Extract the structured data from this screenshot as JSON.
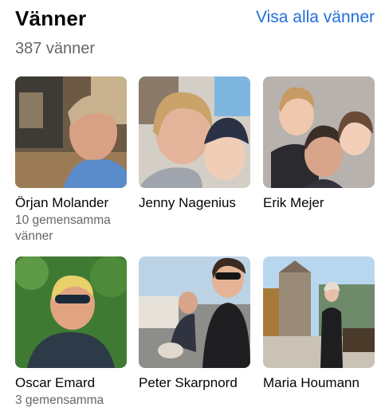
{
  "header": {
    "title": "Vänner",
    "friend_count": "387 vänner",
    "see_all_label": "Visa alla vänner"
  },
  "colors": {
    "link": "#216fdb",
    "secondary_text": "#65676b",
    "primary_text": "#050505"
  },
  "friends": [
    {
      "name": "Örjan Molander",
      "mutual": "10 gemensamma vänner"
    },
    {
      "name": "Jenny Nagenius",
      "mutual": ""
    },
    {
      "name": "Erik Mejer",
      "mutual": ""
    },
    {
      "name": "Oscar Emard",
      "mutual": "3 gemensamma"
    },
    {
      "name": "Peter Skarpnord",
      "mutual": ""
    },
    {
      "name": "Maria Houmann",
      "mutual": ""
    }
  ]
}
